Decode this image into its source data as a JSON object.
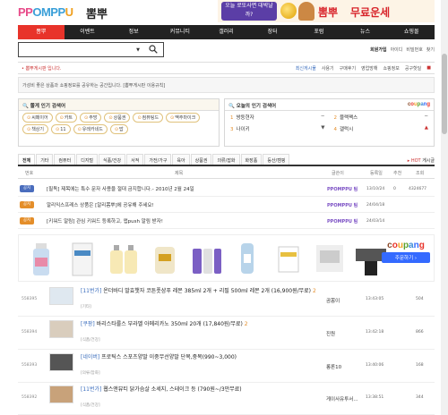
{
  "header": {
    "logo": [
      "PP",
      "OMPP",
      "U"
    ],
    "logo_kr": "뽐뿌",
    "banner": {
      "badge": "오늘 로또사면 대박날까?",
      "logo": "뽐뿌",
      "text": "무료운세"
    }
  },
  "nav": [
    "뽐뿌",
    "이벤트",
    "정보",
    "커뮤니티",
    "갤러리",
    "장터",
    "포럼",
    "뉴스",
    "쇼핑몰"
  ],
  "search": {
    "value": "",
    "select_label": "▼",
    "login_links": [
      "회원가입",
      "아이디",
      "비밀번호",
      "찾기"
    ]
  },
  "board": {
    "name": "• 뽐뿌게시판 입니다.",
    "links": [
      "최신게시물",
      "사용기",
      "구매후기",
      "영업방해",
      "쇼핑정보",
      "공구핫딜",
      "■"
    ],
    "description": "가성비 좋은 상품과 쇼핑정보를 공유하는 공간입니다. [뽐뿌게시판 이용규칙]"
  },
  "hot_search": {
    "title": "🔍 쫄게 인기 검색어",
    "tags": [
      "씨페이어",
      "카트",
      "주방",
      "상품권",
      "컴퓨팅드",
      "맥주마이크",
      "책상기",
      "11",
      "유레카네드",
      "밥"
    ]
  },
  "popular": {
    "title": "🔍 오늘의 인기 검색어",
    "brand": "coupang",
    "items": [
      {
        "rank": "1",
        "text": "쌍둥현자",
        "change": "−"
      },
      {
        "rank": "2",
        "text": "블랙팩스",
        "change": "−"
      },
      {
        "rank": "3",
        "text": "나이키",
        "change": "▼"
      },
      {
        "rank": "4",
        "text": "갤럭시",
        "change": "▲"
      }
    ]
  },
  "categories": [
    "전체",
    "기타",
    "컴퓨터",
    "디지털",
    "식품/건강",
    "서적",
    "가전/가구",
    "육아",
    "상품권",
    "의류/잡화",
    "화장품",
    "등산/캠핑"
  ],
  "hot_link": {
    "prefix": "▸ HOT",
    "label": "게시글"
  },
  "table_headers": [
    "번호",
    "제목",
    "글쓴이",
    "등록일",
    "추천",
    "조회"
  ],
  "notices": [
    {
      "badge": "공지",
      "badge_color": "#4a6dbd",
      "title": "[필독] 제목에는 특수 문자 사용을 절대 금지합니다.- 2010년 2월 24일",
      "writer": "PPOMPPU 팀",
      "date": "13/10/24",
      "rec": "0",
      "views": "4324677"
    },
    {
      "badge": "공지",
      "badge_color": "#e48e2a",
      "title": "알리익스프레스 상품은 [알리뽐뿌]에 공유해 주세요!",
      "writer": "PPOMPPU 팀",
      "date": "24/04/18",
      "rec": "",
      "views": ""
    },
    {
      "badge": "공지",
      "badge_color": "#e48e2a",
      "title": "[키워드 알림] 관심 키워드 등록하고, 앱push 알림 받자!",
      "writer": "PPOMPPU 팀",
      "date": "24/03/14",
      "rec": "",
      "views": ""
    }
  ],
  "ad": {
    "brand": "coupang",
    "button": "주문하기 ›"
  },
  "posts": [
    {
      "id": "558395",
      "prefix": "[11번가]",
      "title": " 온더바디 발효챗자 코튼풋샴푸 레몬 385ml 2개 + 리필 500ml 레몬 2개 (16,900원/무료)",
      "comments": "2",
      "cat": "[기타]",
      "writer": "곰뽐이",
      "time": "13:43:05",
      "rec": "",
      "views": "504",
      "thumb": "#dfe8f0"
    },
    {
      "id": "558394",
      "prefix": "[쿠팡]",
      "title": " 바리스타룰스 부라벨 아메리카노 350ml 20개 (17,840원/무료)",
      "comments": "2",
      "cat": "[식품/건강]",
      "writer": "진원",
      "time": "13:42:18",
      "rec": "",
      "views": "866",
      "thumb": "#d9cdbd"
    },
    {
      "id": "558393",
      "prefix": "[네이버]",
      "title": " 프로틱스 스포츠양말 이중무선양말 단목,중목(990~3,000)",
      "comments": "",
      "cat": "[의류/잡화]",
      "writer": "롱론10",
      "time": "13:40:06",
      "rec": "",
      "views": "168",
      "thumb": "#555"
    },
    {
      "id": "558392",
      "prefix": "[11번가]",
      "title": " 웹스앤뷰티 닭가슴살 소세지, 스테이크 등 (790원~/3만무료)",
      "comments": "",
      "cat": "[식품/건강]",
      "writer": "게이사유투서...",
      "time": "13:38:51",
      "rec": "",
      "views": "344",
      "thumb": "#c8a27a"
    }
  ]
}
